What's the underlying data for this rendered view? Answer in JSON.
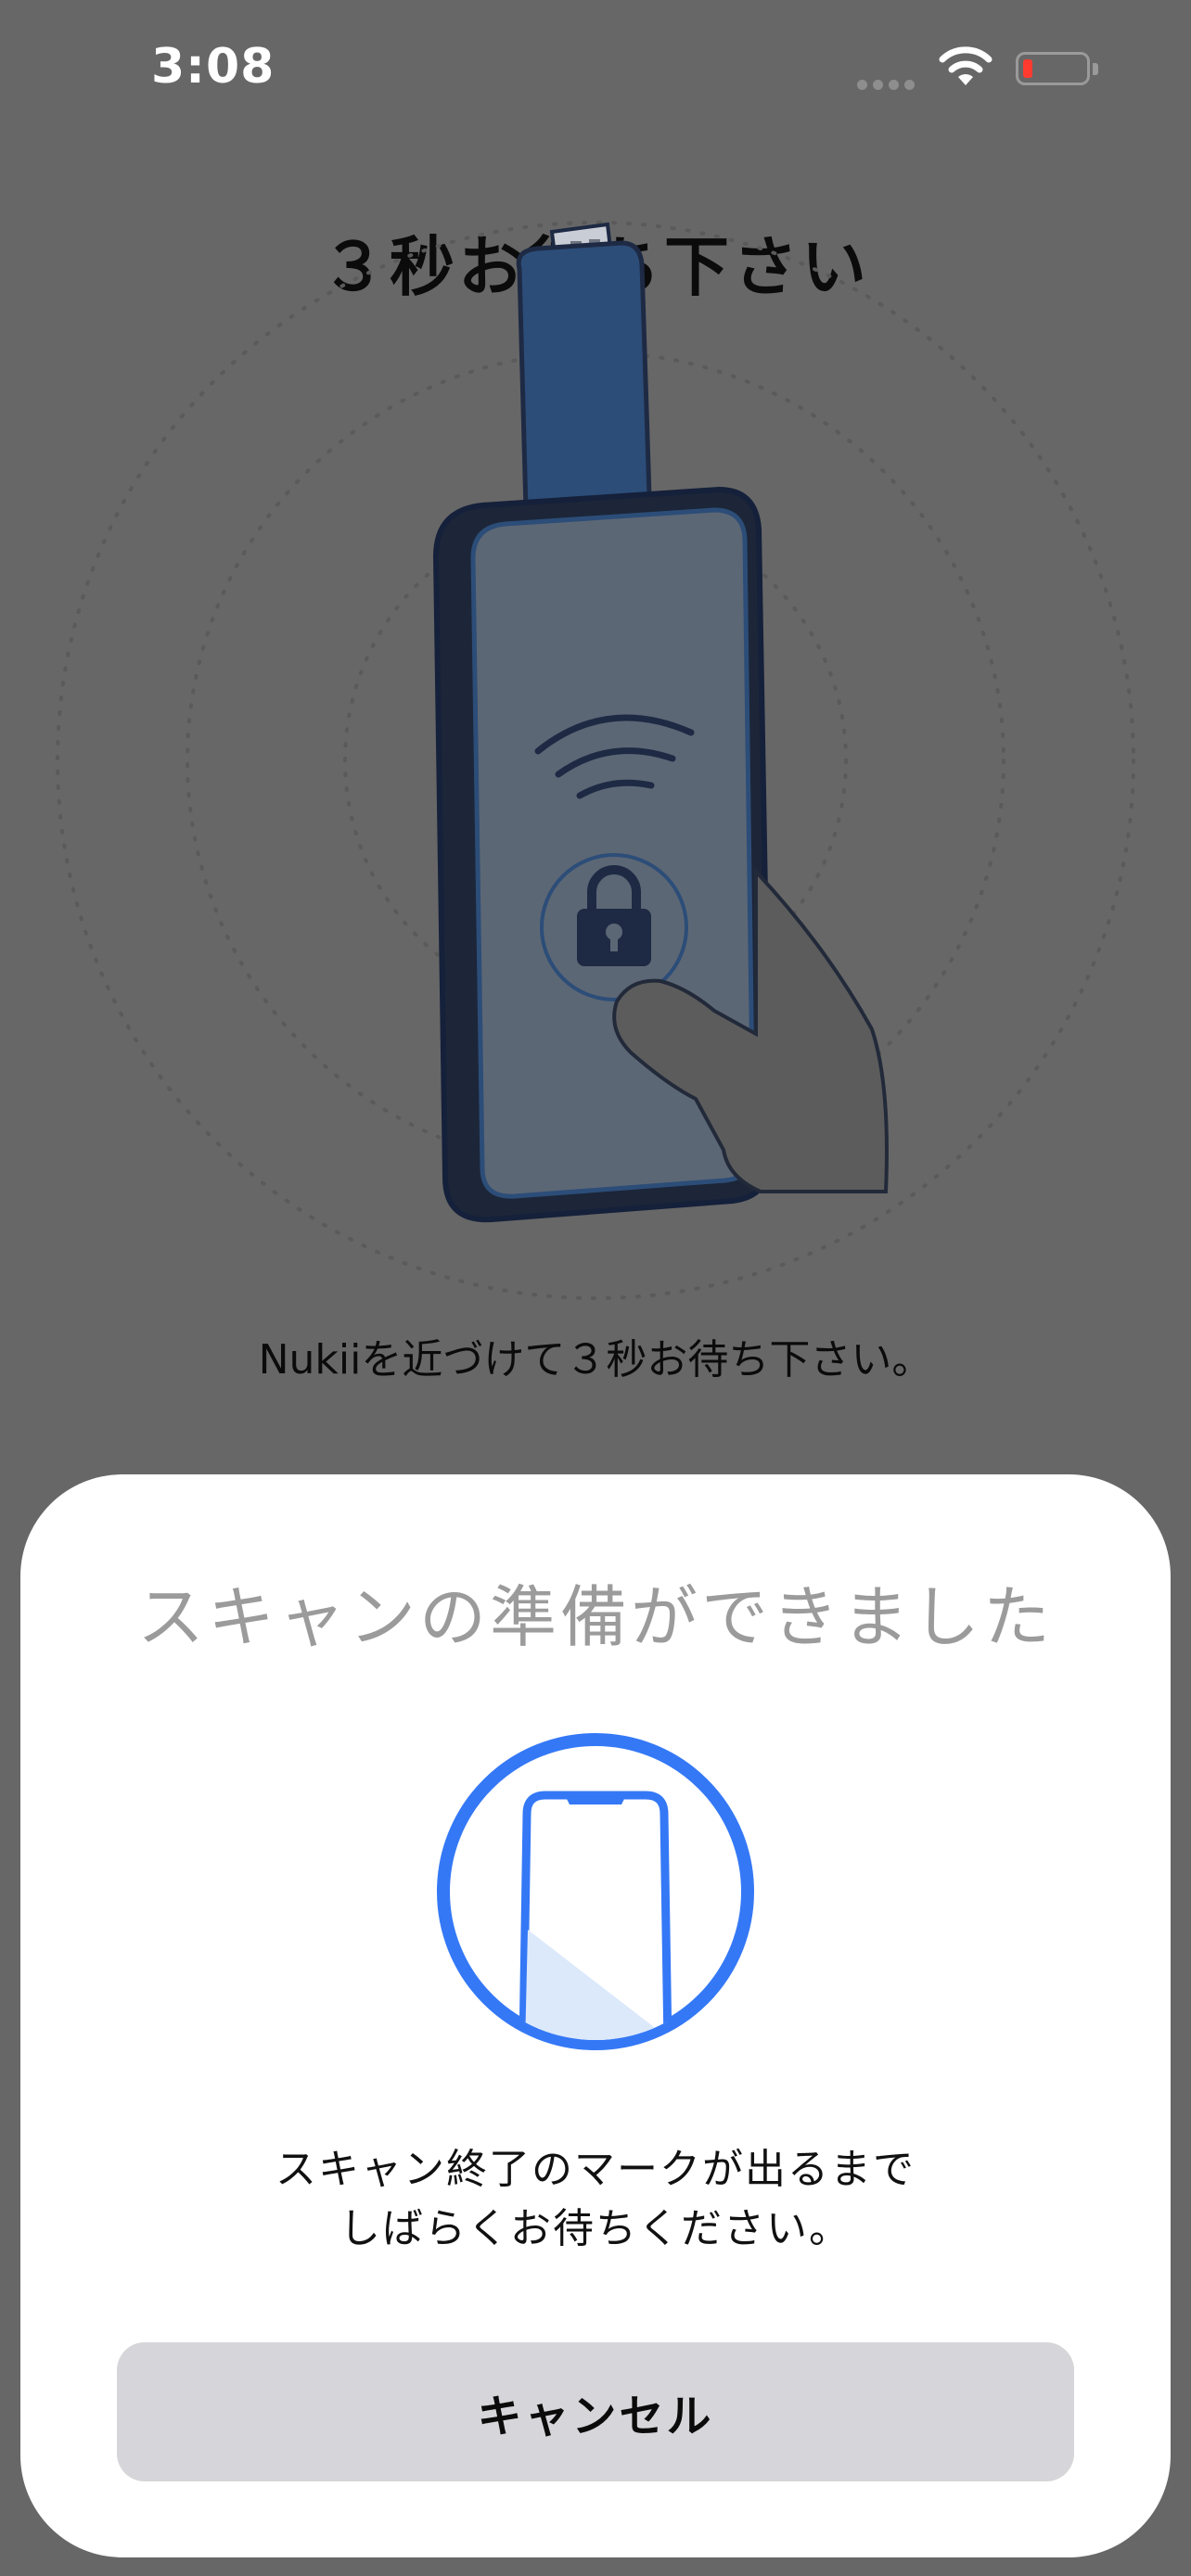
{
  "status_bar": {
    "time": "3:08",
    "icons": [
      "cellular-signal-icon",
      "wifi-icon",
      "battery-low-icon"
    ]
  },
  "page": {
    "title": "３秒お待ち下さい",
    "instruction": "Nukiiを近づけて３秒お待ち下さい。"
  },
  "scan_sheet": {
    "title": "スキャンの準備ができました",
    "message_line1": "スキャン終了のマークが出るまで",
    "message_line2": "しばらくお待ちください。",
    "cancel_label": "キャンセル",
    "icon": "phone-in-circle-icon"
  },
  "colors": {
    "background": "#676767",
    "sheet_background": "#ffffff",
    "accent_blue": "#3478f6",
    "button_background": "#d6d6da",
    "battery_low": "#ff3b30"
  }
}
